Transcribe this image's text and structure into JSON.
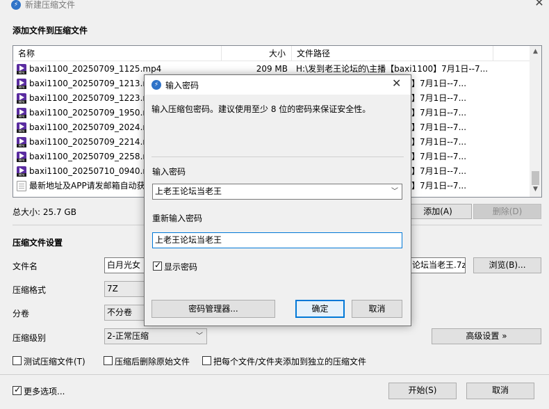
{
  "window": {
    "title": "新建压缩文件",
    "close_glyph": "✕"
  },
  "add_section": {
    "title": "添加文件到压缩文件"
  },
  "file_table": {
    "columns": [
      "名称",
      "大小",
      "文件路径"
    ],
    "rows": [
      {
        "icon": "mp4-file-icon",
        "name": "baxi1100_20250709_1125.mp4",
        "size": "209 MB",
        "path": "H:\\发到老王论坛的\\主播【baxi1100】7月1日--7..."
      },
      {
        "icon": "mp4-file-icon",
        "name": "baxi1100_20250709_1213.mp",
        "size": "",
        "path": "】7月1日--7..."
      },
      {
        "icon": "mp4-file-icon",
        "name": "baxi1100_20250709_1223.mp",
        "size": "",
        "path": "】7月1日--7..."
      },
      {
        "icon": "mp4-file-icon",
        "name": "baxi1100_20250709_1950.mp",
        "size": "",
        "path": "】7月1日--7..."
      },
      {
        "icon": "mp4-file-icon",
        "name": "baxi1100_20250709_2024.mp",
        "size": "",
        "path": "】7月1日--7..."
      },
      {
        "icon": "mp4-file-icon",
        "name": "baxi1100_20250709_2214.mp",
        "size": "",
        "path": "】7月1日--7..."
      },
      {
        "icon": "mp4-file-icon",
        "name": "baxi1100_20250709_2258.mp",
        "size": "",
        "path": "】7月1日--7..."
      },
      {
        "icon": "mp4-file-icon",
        "name": "baxi1100_20250710_0940.mp",
        "size": "",
        "path": "】7月1日--7..."
      },
      {
        "icon": "text-file-icon",
        "name": "最新地址及APP请发邮箱自动获",
        "size": "",
        "path": "】7月1日--7..."
      }
    ]
  },
  "total_size": "总大小: 25.7 GB",
  "buttons": {
    "add": "添加(A)",
    "delete": "删除(D)",
    "browse": "浏览(B)...",
    "advanced": "高级设置 »",
    "start": "开始(S)",
    "cancel": "取消"
  },
  "settings": {
    "title": "压缩文件设置",
    "filename_label": "文件名",
    "filename_left": "白月光女",
    "filename_right": "论坛当老王.7z",
    "format_label": "压缩格式",
    "format_value": "7Z",
    "volume_label": "分卷",
    "volume_value": "不分卷",
    "level_label": "压缩级别",
    "level_value": "2-正常压缩"
  },
  "options": {
    "test": "测试压缩文件(T)",
    "delete_after": "压缩后删除原始文件",
    "separate": "把每个文件/文件夹添加到独立的压缩文件",
    "more": "更多选项..."
  },
  "dialog": {
    "title": "输入密码",
    "description": "输入压缩包密码。建议使用至少 8 位的密码来保证安全性。",
    "password_label": "输入密码",
    "password_value": "上老王论坛当老王",
    "reenter_label": "重新输入密码",
    "reenter_value": "上老王论坛当老王",
    "show_password": "显示密码",
    "manager_button": "密码管理器...",
    "ok_button": "确定",
    "cancel_button": "取消",
    "close_glyph": "✕"
  }
}
